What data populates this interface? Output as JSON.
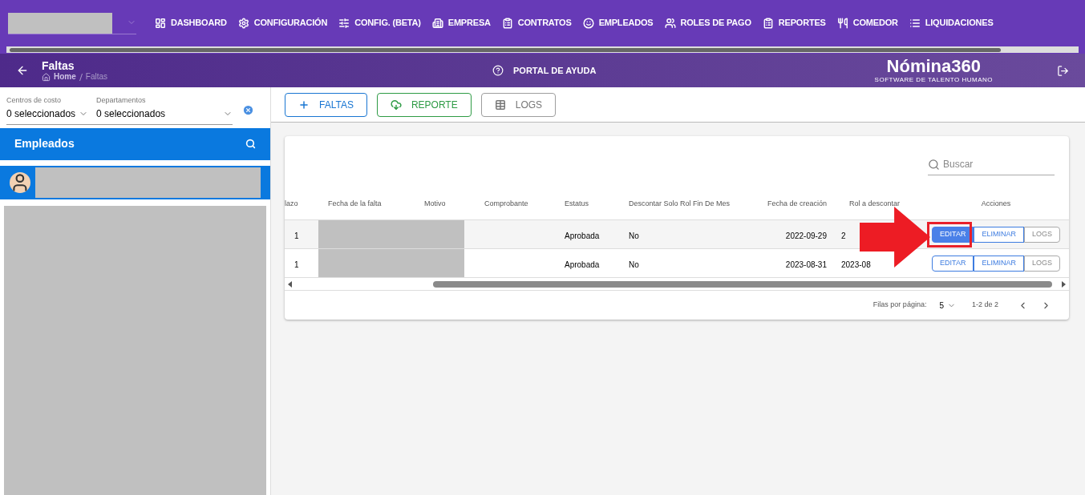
{
  "nav": [
    "DASHBOARD",
    "CONFIGURACIÓN",
    "CONFIG. (BETA)",
    "EMPRESA",
    "CONTRATOS",
    "EMPLEADOS",
    "ROLES DE PAGO",
    "REPORTES",
    "COMEDOR",
    "LIQUIDACIONES"
  ],
  "header": {
    "title": "Faltas",
    "breadcrumb": [
      "Home",
      "Faltas"
    ],
    "help": "PORTAL DE AYUDA",
    "logo": "Nómina360",
    "logo_tagline": "SOFTWARE DE TALENTO HUMANO"
  },
  "filters": [
    {
      "label": "Centros de costo",
      "value": "0 seleccionados"
    },
    {
      "label": "Departamentos",
      "value": "0 seleccionados"
    }
  ],
  "employees": {
    "title": "Empleados"
  },
  "toolbar": [
    {
      "kind": "add",
      "label": "FALTAS"
    },
    {
      "kind": "report",
      "label": "REPORTE"
    },
    {
      "kind": "logs",
      "label": "LOGS"
    }
  ],
  "search": {
    "placeholder": "Buscar"
  },
  "table": {
    "columns": [
      "lazo",
      "Fecha de la falta",
      "Motivo",
      "Comprobante",
      "Estatus",
      "Descontar Solo Rol Fin De Mes",
      "Fecha de creación",
      "Rol a descontar",
      "Acciones"
    ],
    "rows": [
      {
        "plazo": "1",
        "estatus": "Aprobada",
        "descontar": "No",
        "creacion": "2022-09-29",
        "rol": "2",
        "highlighted": true,
        "marked": true,
        "actions": [
          "EDITAR",
          "ELIMINAR",
          "LOGS"
        ]
      },
      {
        "plazo": "1",
        "estatus": "Aprobada",
        "descontar": "No",
        "creacion": "2023-08-31",
        "rol": "2023-08",
        "highlighted": false,
        "marked": false,
        "actions": [
          "EDITAR",
          "ELIMINAR",
          "LOGS"
        ]
      }
    ]
  },
  "pagination": {
    "label": "Filas por página:",
    "per_page": "5",
    "range": "1-2 de 2"
  }
}
